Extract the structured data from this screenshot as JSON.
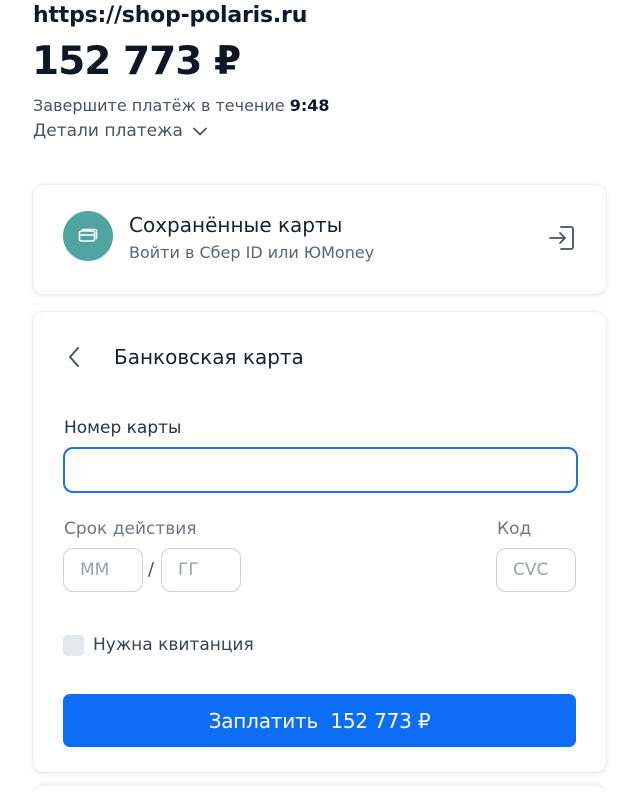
{
  "header": {
    "site_url": "https://shop-polaris.ru",
    "amount": "152 773 ₽",
    "timer_prefix": "Завершите платёж в течение ",
    "timer_value": "9:48",
    "details_label": "Детали платежа"
  },
  "saved_cards": {
    "title": "Сохранённые карты",
    "subtitle": "Войти в Сбер ID или ЮMoney",
    "icon": "card-icon",
    "action_icon": "login-arrow-icon",
    "avatar_color": "#4fa3a0"
  },
  "bank_card": {
    "heading": "Банковская карта",
    "card_number_label": "Номер карты",
    "card_number_value": "",
    "expiry_label": "Срок действия",
    "month_placeholder": "ММ",
    "year_placeholder": "ГГ",
    "separator": "/",
    "code_label": "Код",
    "cvc_placeholder": "CVC",
    "receipt_label": "Нужна квитанция",
    "receipt_checked": false,
    "pay_label": "Заплатить  152 773 ₽"
  },
  "colors": {
    "accent": "#0d6ef5",
    "focus_border": "#1a73e8",
    "text_dark": "#0f1724",
    "text_muted": "#4a5260"
  }
}
